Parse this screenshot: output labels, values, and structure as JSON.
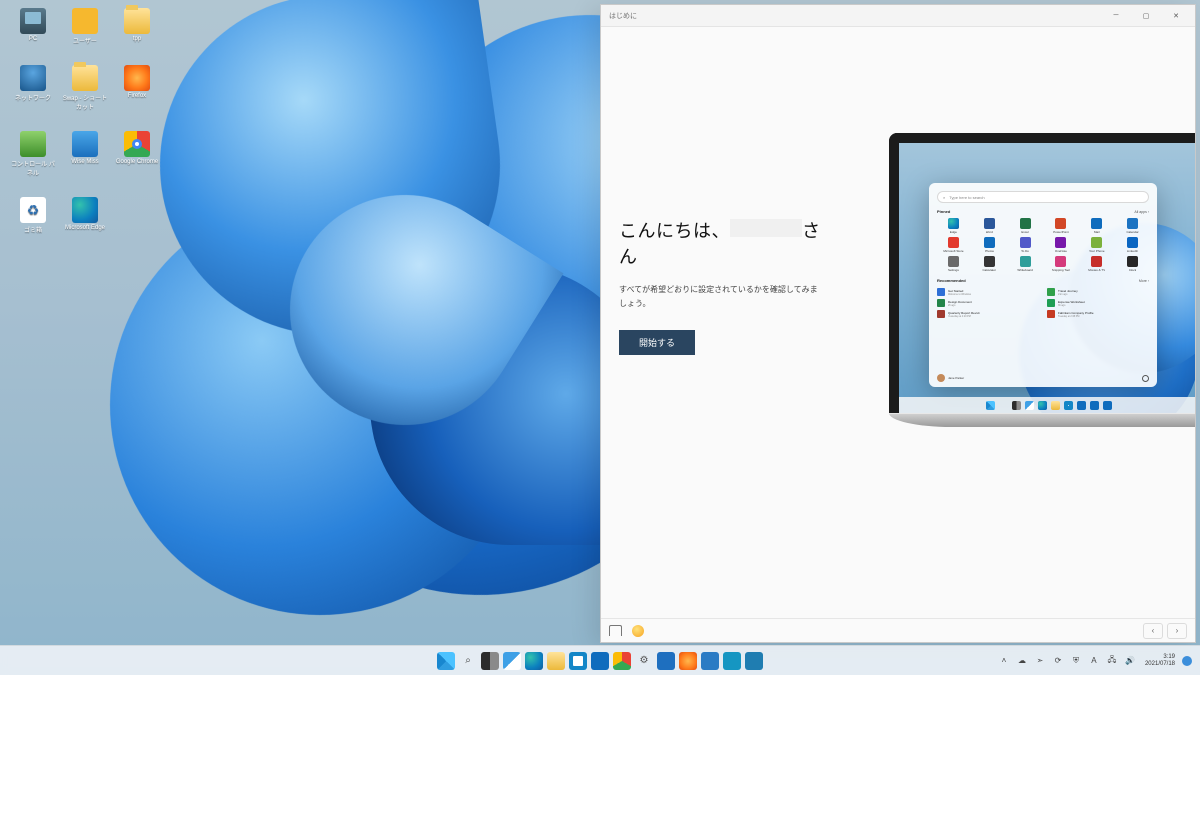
{
  "desktop_icons": [
    {
      "label": "PC",
      "name": "desktop-icon-pc",
      "cls": "ic-pc"
    },
    {
      "label": "ユーザー",
      "name": "desktop-icon-user",
      "cls": "ic-user"
    },
    {
      "label": "tpp",
      "name": "desktop-icon-tpp",
      "cls": "ic-fold"
    },
    {
      "label": "ネットワーク",
      "name": "desktop-icon-network",
      "cls": "ic-net"
    },
    {
      "label": "Swap - ショートカット",
      "name": "desktop-icon-swap",
      "cls": "ic-fold"
    },
    {
      "label": "Firefox",
      "name": "desktop-icon-firefox",
      "cls": "ic-ff"
    },
    {
      "label": "コントロール パネル",
      "name": "desktop-icon-control-panel",
      "cls": "ic-cp"
    },
    {
      "label": "Wise Miss",
      "name": "desktop-icon-wisemiss",
      "cls": "ic-ws"
    },
    {
      "label": "Google Chrome",
      "name": "desktop-icon-chrome",
      "cls": "ic-gc"
    },
    {
      "label": "ゴミ箱",
      "name": "desktop-icon-recycle-bin",
      "cls": "ic-rc"
    },
    {
      "label": "Microsoft Edge",
      "name": "desktop-icon-edge",
      "cls": "ic-ed"
    }
  ],
  "window": {
    "title": "はじめに",
    "greeting_before": "こんにちは、",
    "greeting_after": "さん",
    "body": "すべてが希望どおりに設定されているかを確認してみましょう。",
    "start": "開始する"
  },
  "startmenu": {
    "search_placeholder": "Type here to search",
    "pinned_label": "Pinned",
    "recommended_label": "Recommended",
    "all_apps": "All apps  ›",
    "more": "More  ›",
    "user": "Jane Parker",
    "pinned": [
      {
        "label": "Edge",
        "cls": "c-edge"
      },
      {
        "label": "Word",
        "cls": "c-w"
      },
      {
        "label": "Excel",
        "cls": "c-e"
      },
      {
        "label": "PowerPoint",
        "cls": "c-p"
      },
      {
        "label": "Mail",
        "cls": "c-ml"
      },
      {
        "label": "Calendar",
        "cls": "c-cal"
      },
      {
        "label": "Microsoft Store",
        "cls": "c-ms"
      },
      {
        "label": "Photos",
        "cls": "c-ph"
      },
      {
        "label": "To Do",
        "cls": "c-td"
      },
      {
        "label": "OneNote",
        "cls": "c-on"
      },
      {
        "label": "Your Phone",
        "cls": "c-yp"
      },
      {
        "label": "LinkedIn",
        "cls": "c-li"
      },
      {
        "label": "Settings",
        "cls": "c-st"
      },
      {
        "label": "Calculator",
        "cls": "c-ca"
      },
      {
        "label": "Whiteboard",
        "cls": "c-wb"
      },
      {
        "label": "Snipping Tool",
        "cls": "c-sn"
      },
      {
        "label": "Movies & TV",
        "cls": "c-mv"
      },
      {
        "label": "Clock",
        "cls": "c-ck"
      }
    ],
    "recommended": [
      {
        "title": "Get Started",
        "sub": "Welcome to Windows",
        "cls": "c-gs"
      },
      {
        "title": "Travel Journey",
        "sub": "21m ago",
        "cls": "c-tj"
      },
      {
        "title": "Design Document",
        "sub": "2h ago",
        "cls": "c-dd"
      },
      {
        "title": "Expense Worksheet",
        "sub": "3h ago",
        "cls": "c-ew"
      },
      {
        "title": "Quarterly Report Revs4",
        "sub": "Yesterday at 4:20 PM",
        "cls": "c-pr"
      },
      {
        "title": "Fabrikam Company Profile",
        "sub": "Tuesday at 2:38 PM",
        "cls": "c-cp"
      }
    ]
  },
  "taskbar": {
    "center": [
      {
        "name": "start-button",
        "cls": "c-start"
      },
      {
        "name": "search-button",
        "cls": "c-search",
        "glyph": "⌕"
      },
      {
        "name": "task-view-button",
        "cls": "c-task"
      },
      {
        "name": "widgets-button",
        "cls": "c-widg"
      },
      {
        "name": "edge-taskbar-icon",
        "cls": "c-edge"
      },
      {
        "name": "explorer-taskbar-icon",
        "cls": "c-fold"
      },
      {
        "name": "store-taskbar-icon",
        "cls": "c-store"
      },
      {
        "name": "mail-taskbar-icon",
        "cls": "c-mail"
      },
      {
        "name": "chrome-taskbar-icon",
        "cls": "c-gc"
      },
      {
        "name": "settings-taskbar-icon",
        "cls": "c-set",
        "glyph": "⚙"
      },
      {
        "name": "security-taskbar-icon",
        "cls": "c-sec"
      },
      {
        "name": "firefox-taskbar-icon",
        "cls": "c-ff"
      },
      {
        "name": "wise-taskbar-icon",
        "cls": "c-ws"
      },
      {
        "name": "app-a-taskbar-icon",
        "cls": "c-x1"
      },
      {
        "name": "app-b-taskbar-icon",
        "cls": "c-x2"
      }
    ],
    "tray": [
      {
        "name": "chevron-up-icon",
        "glyph": "˄"
      },
      {
        "name": "onedrive-tray-icon",
        "glyph": "☁"
      },
      {
        "name": "bluetooth-tray-icon",
        "glyph": "➣"
      },
      {
        "name": "sync-tray-icon",
        "glyph": "⟳"
      },
      {
        "name": "shield-tray-icon",
        "glyph": "⛨"
      },
      {
        "name": "ime-tray-icon",
        "glyph": "A"
      },
      {
        "name": "network-tray-icon",
        "glyph": "🖧"
      },
      {
        "name": "volume-tray-icon",
        "glyph": "🔊"
      }
    ],
    "time": "3:19",
    "date": "2021/07/18"
  }
}
